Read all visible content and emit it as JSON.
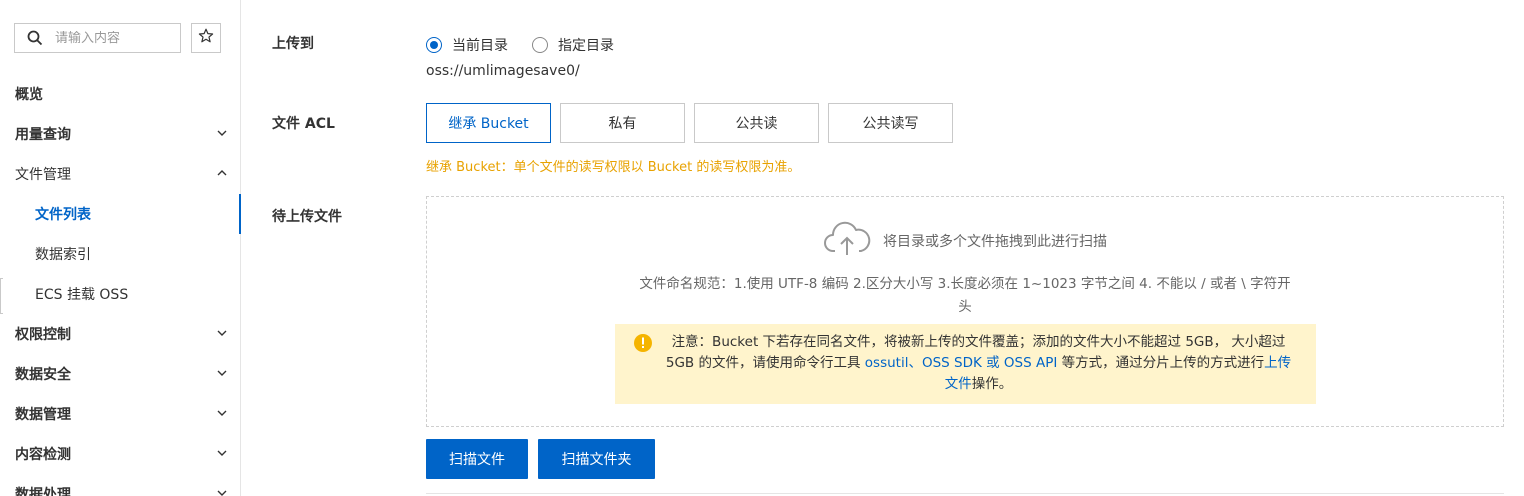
{
  "sidebar": {
    "search_placeholder": "请输入内容",
    "items": [
      {
        "label": "概览"
      },
      {
        "label": "用量查询"
      },
      {
        "label": "文件管理"
      },
      {
        "label": "文件列表"
      },
      {
        "label": "数据索引"
      },
      {
        "label": "ECS 挂载 OSS"
      },
      {
        "label": "权限控制"
      },
      {
        "label": "数据安全"
      },
      {
        "label": "数据管理"
      },
      {
        "label": "内容检测"
      },
      {
        "label": "数据处理"
      }
    ]
  },
  "form": {
    "upload_to_label": "上传到",
    "radio_current": "当前目录",
    "radio_specified": "指定目录",
    "path": "oss://umlimagesave0/",
    "acl_label": "文件 ACL",
    "acl_options": [
      "继承 Bucket",
      "私有",
      "公共读",
      "公共读写"
    ],
    "acl_hint": "继承 Bucket：单个文件的读写权限以 Bucket 的读写权限为准。",
    "pending_label": "待上传文件",
    "drop_text": "将目录或多个文件拖拽到此进行扫描",
    "rules_line1": "文件命名规范：1.使用 UTF-8 编码 2.区分大小写 3.长度必须在 1~1023 字节之间 4. 不能以 / 或者 \\ 字符开",
    "rules_line2": "头",
    "notice": {
      "part1": "注意：Bucket 下若存在同名文件，将被新上传的文件覆盖；添加的文件大小不能超过 5GB， 大小超过 5GB 的文件，请使用命令行工具 ",
      "link1": "ossutil、OSS SDK 或 OSS API",
      "part2": " 等方式，通过分片上传的方式进行",
      "link2": "上传文件",
      "part3": "操作。"
    },
    "scan_files_button": "扫描文件",
    "scan_folder_button": "扫描文件夹"
  },
  "colors": {
    "accent": "#0064c8",
    "hint": "#e8a200",
    "notice_bg": "#fff4cc"
  }
}
